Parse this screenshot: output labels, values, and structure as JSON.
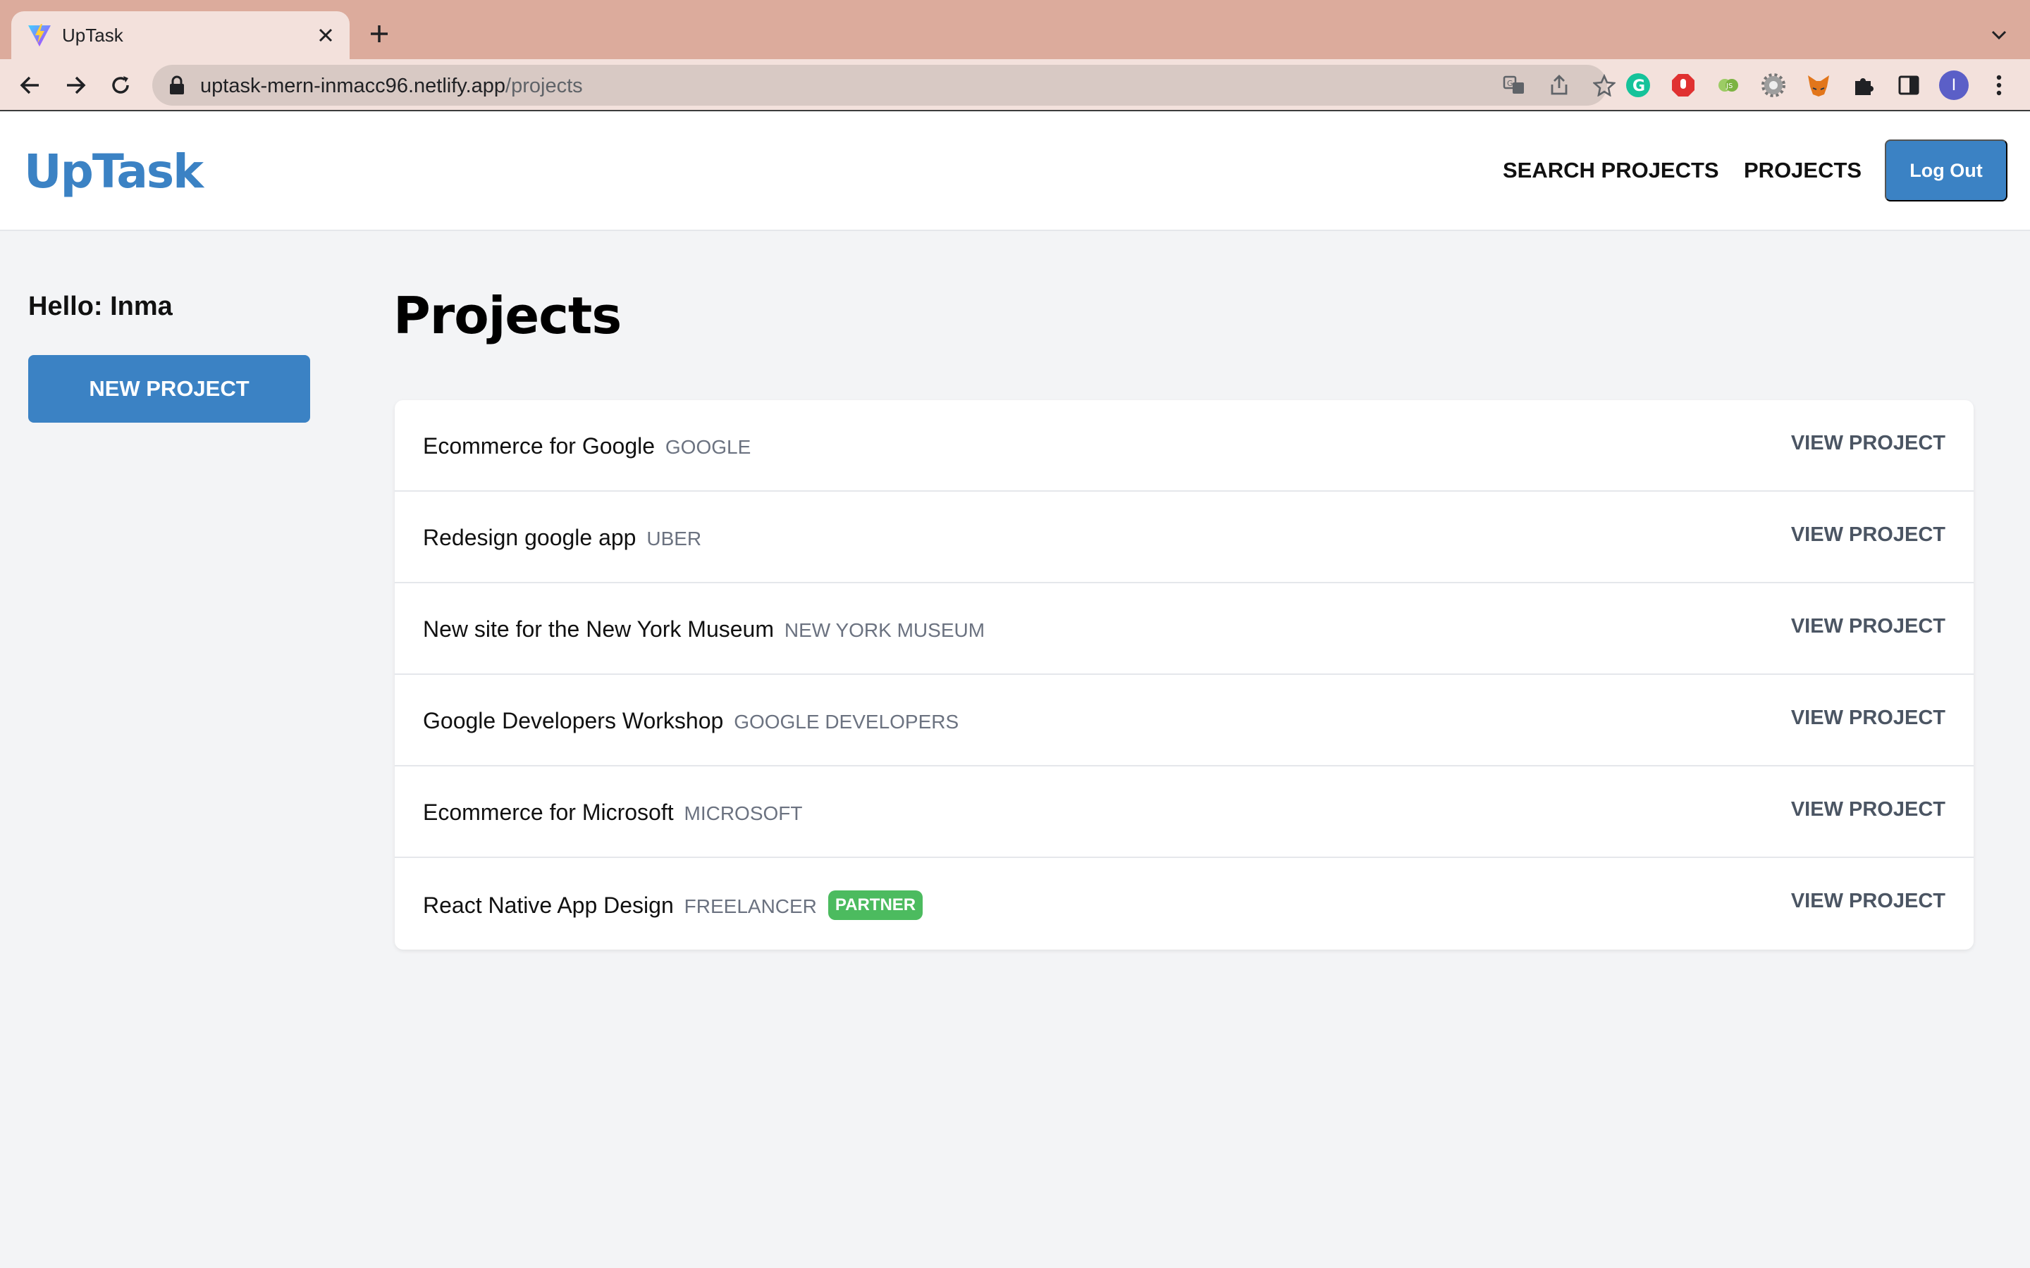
{
  "browser": {
    "tab_title": "UpTask",
    "url_host": "uptask-mern-inmacc96.netlify.app",
    "url_path": "/projects",
    "profile_initial": "I",
    "icons": [
      "vite-favicon",
      "close-icon",
      "plus-icon",
      "chevron-down-icon",
      "back-arrow-icon",
      "forward-arrow-icon",
      "reload-icon",
      "lock-icon",
      "translate-icon",
      "share-icon",
      "star-icon",
      "grammarly-icon",
      "adblock-icon",
      "node-icon",
      "settings-gear-icon",
      "metamask-fox-icon",
      "puzzle-icon",
      "sidepanel-icon",
      "kebab-menu-icon"
    ]
  },
  "header": {
    "logo": "UpTask",
    "nav": {
      "search": "Search Projects",
      "projects": "Projects"
    },
    "logout_label": "Log Out",
    "accent": "#3b82c4"
  },
  "sidebar": {
    "greeting": "Hello: Inma",
    "new_project_label": "New Project"
  },
  "main": {
    "title": "Projects",
    "projects": [
      {
        "name": "Ecommerce for Google",
        "client": "GOOGLE",
        "badge": "",
        "action": "View Project"
      },
      {
        "name": "Redesign google app",
        "client": "UBER",
        "badge": "",
        "action": "View Project"
      },
      {
        "name": "New site for the New York Museum",
        "client": "NEW YORK MUSEUM",
        "badge": "",
        "action": "View Project"
      },
      {
        "name": "Google Developers Workshop",
        "client": "GOOGLE DEVELOPERS",
        "badge": "",
        "action": "View Project"
      },
      {
        "name": "Ecommerce for Microsoft",
        "client": "MICROSOFT",
        "badge": "",
        "action": "View Project"
      },
      {
        "name": "React Native App Design",
        "client": "FREELANCER",
        "badge": "Partner",
        "action": "View Project"
      }
    ],
    "badge_color": "#4cbb5f"
  }
}
